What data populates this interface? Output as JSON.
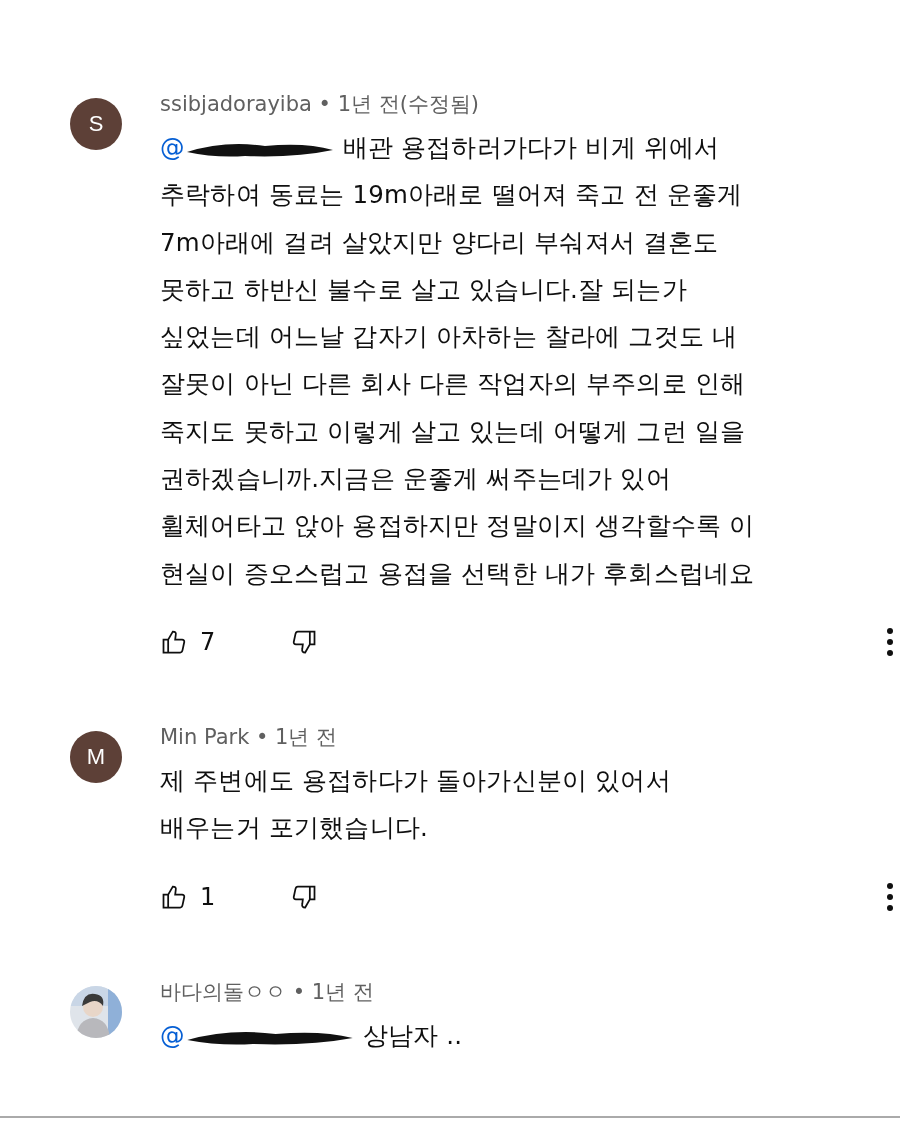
{
  "comments": [
    {
      "avatar": {
        "kind": "letter",
        "letter": "S",
        "color": "#5d4037"
      },
      "author": "ssibjadorayiba",
      "meta": " • 1년 전(수정됨)",
      "mention": "@",
      "lines": [
        "배관 용접하러가다가 비게 위에서",
        "추락하여 동료는 19m아래로 떨어져 죽고 전 운좋게",
        "7m아래에 걸려 살았지만 양다리 부숴져서 결혼도",
        "못하고 하반신 불수로 살고 있습니다.잘 되는가",
        "싶었는데 어느날 갑자기 아차하는 찰라에 그것도 내",
        "잘못이 아닌 다른 회사 다른 작업자의 부주의로 인해",
        "죽지도 못하고 이렇게 살고 있는데 어떻게 그런 일을",
        "권하겠습니까.지금은 운좋게 써주는데가 있어",
        "휠체어타고 앉아 용접하지만 정말이지 생각할수록 이",
        "현실이 증오스럽고 용접을 선택한 내가 후회스럽네요"
      ],
      "likes": "7"
    },
    {
      "avatar": {
        "kind": "letter",
        "letter": "M",
        "color": "#5d4037"
      },
      "author": "Min Park",
      "meta": " • 1년 전",
      "lines": [
        "제 주변에도 용접하다가 돌아가신분이 있어서",
        "배우는거 포기했습니다."
      ],
      "likes": "1"
    },
    {
      "avatar": {
        "kind": "picture"
      },
      "author": "바다의돌ㅇㅇ",
      "meta": " • 1년 전",
      "mention": "@",
      "lines": [
        "상남자 .."
      ]
    }
  ]
}
